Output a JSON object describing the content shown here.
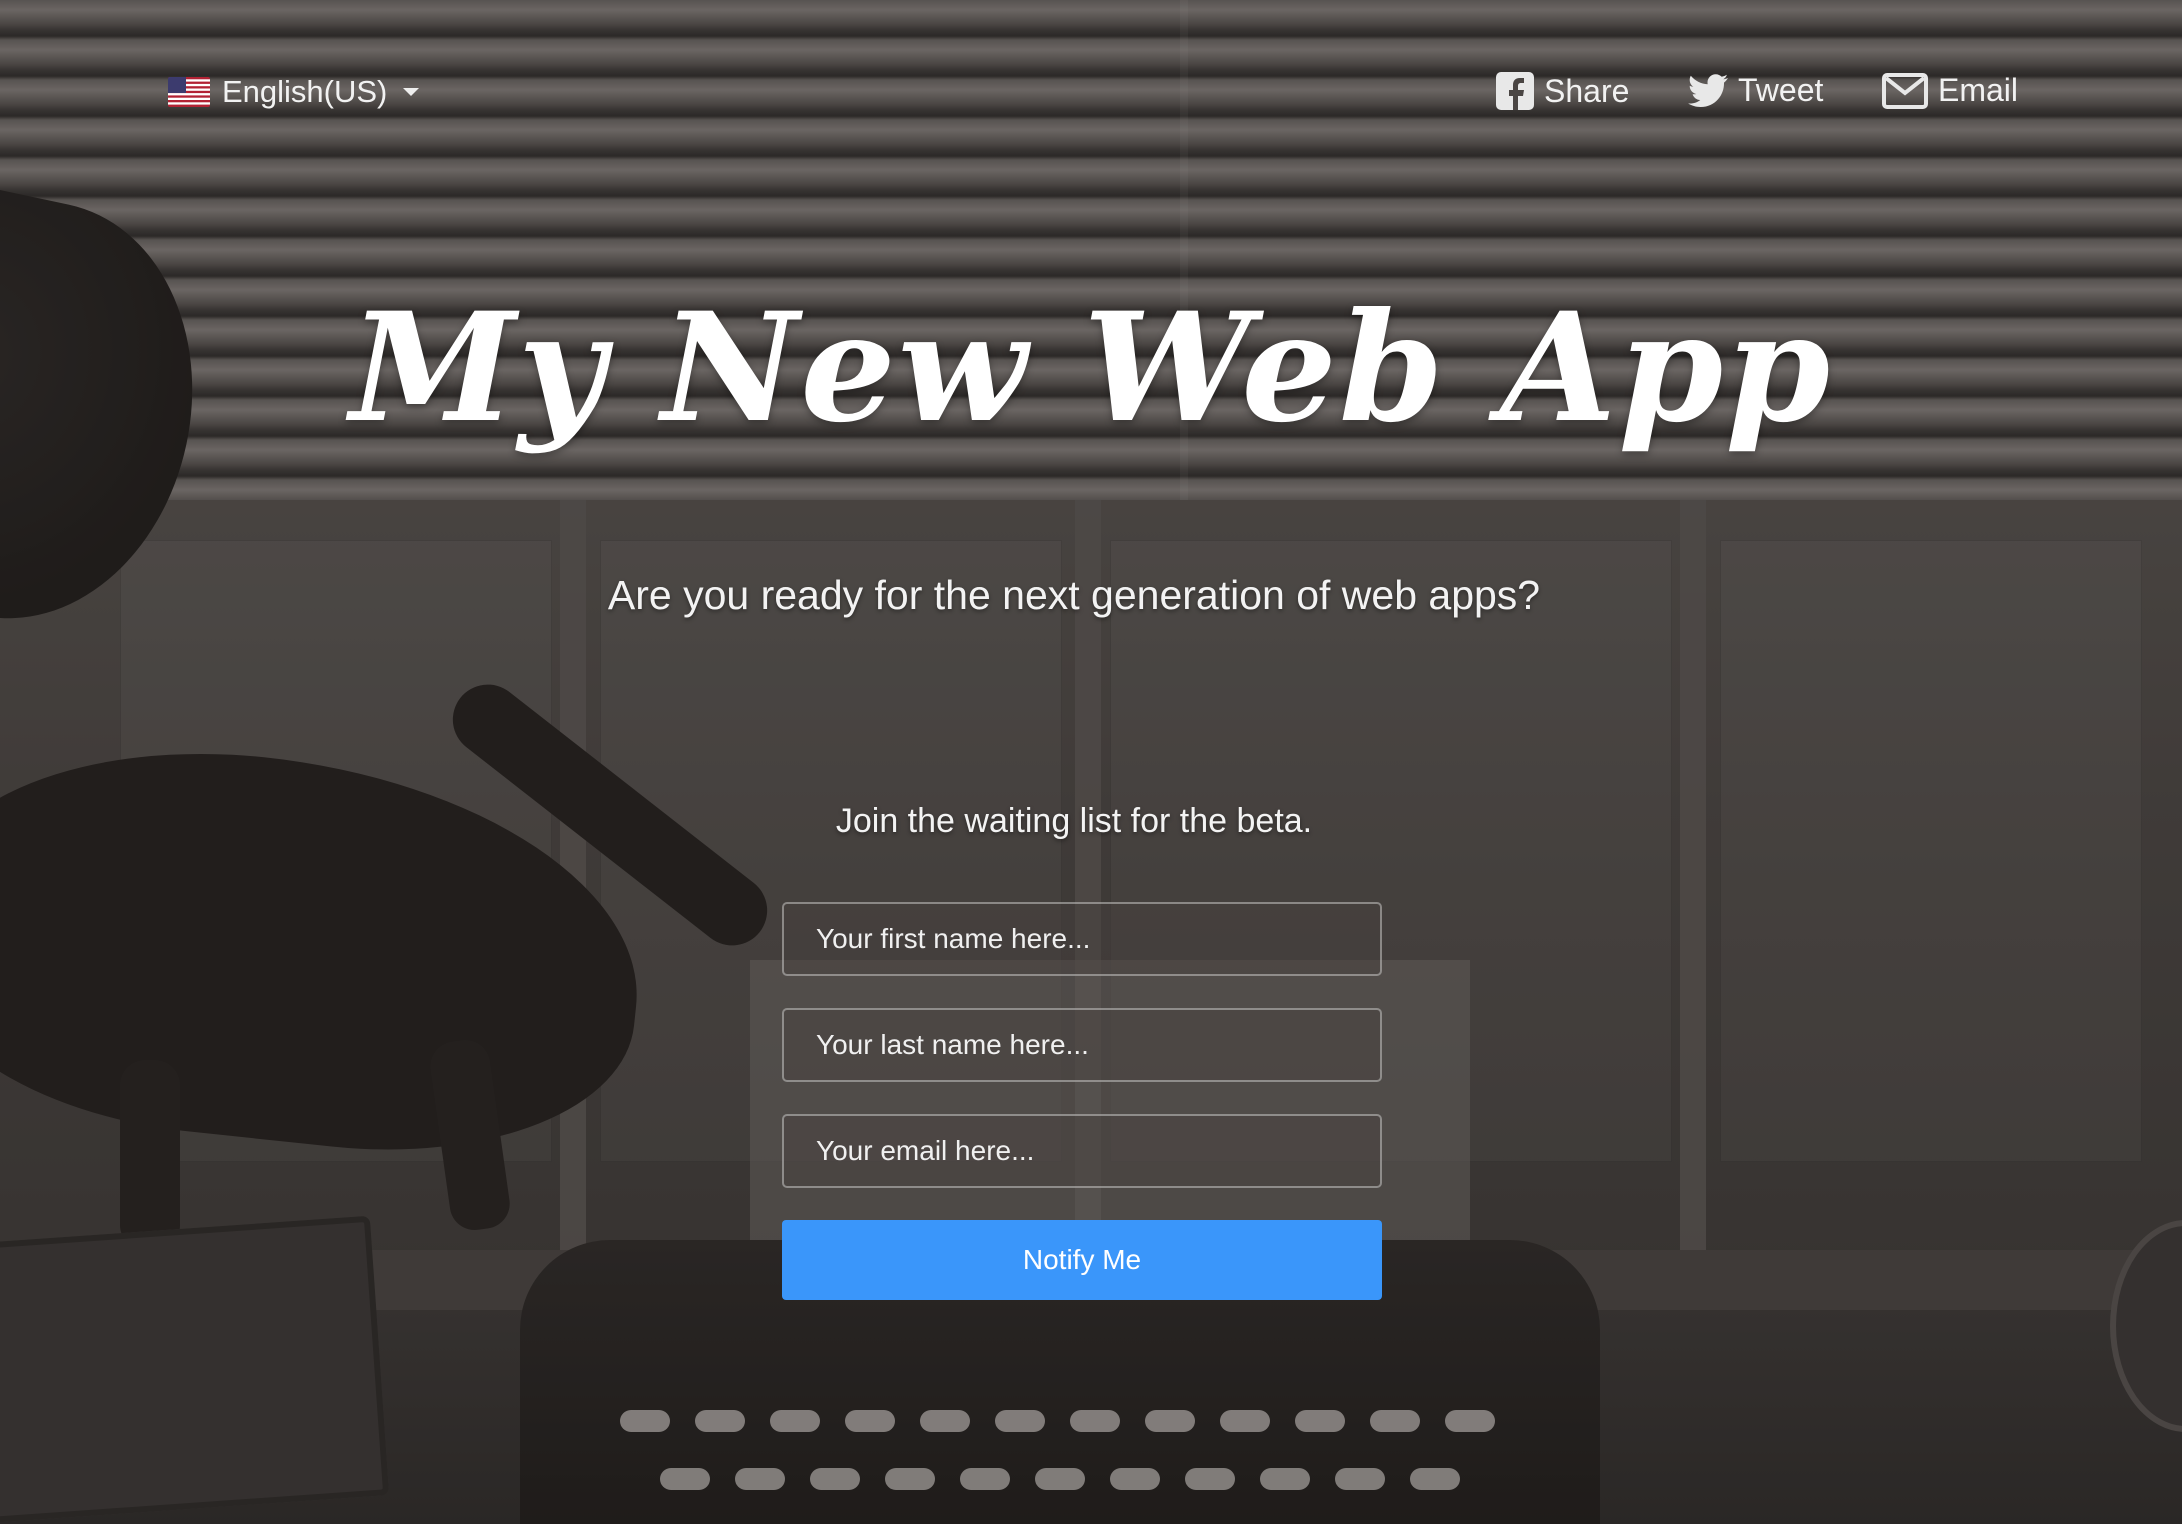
{
  "language": {
    "label": "English(US)",
    "flag_icon": "us-flag-icon"
  },
  "social": {
    "share": {
      "label": "Share",
      "icon": "facebook-icon"
    },
    "tweet": {
      "label": "Tweet",
      "icon": "twitter-icon"
    },
    "email": {
      "label": "Email",
      "icon": "envelope-icon"
    }
  },
  "hero": {
    "title": "My New Web App",
    "subtitle": "Are you ready for the next generation of web apps?"
  },
  "signup": {
    "heading": "Join the waiting list for the beta.",
    "first_name_placeholder": "Your first name here...",
    "last_name_placeholder": "Your last name here...",
    "email_placeholder": "Your email here...",
    "button_label": "Notify Me",
    "button_color": "#3a96fa"
  }
}
